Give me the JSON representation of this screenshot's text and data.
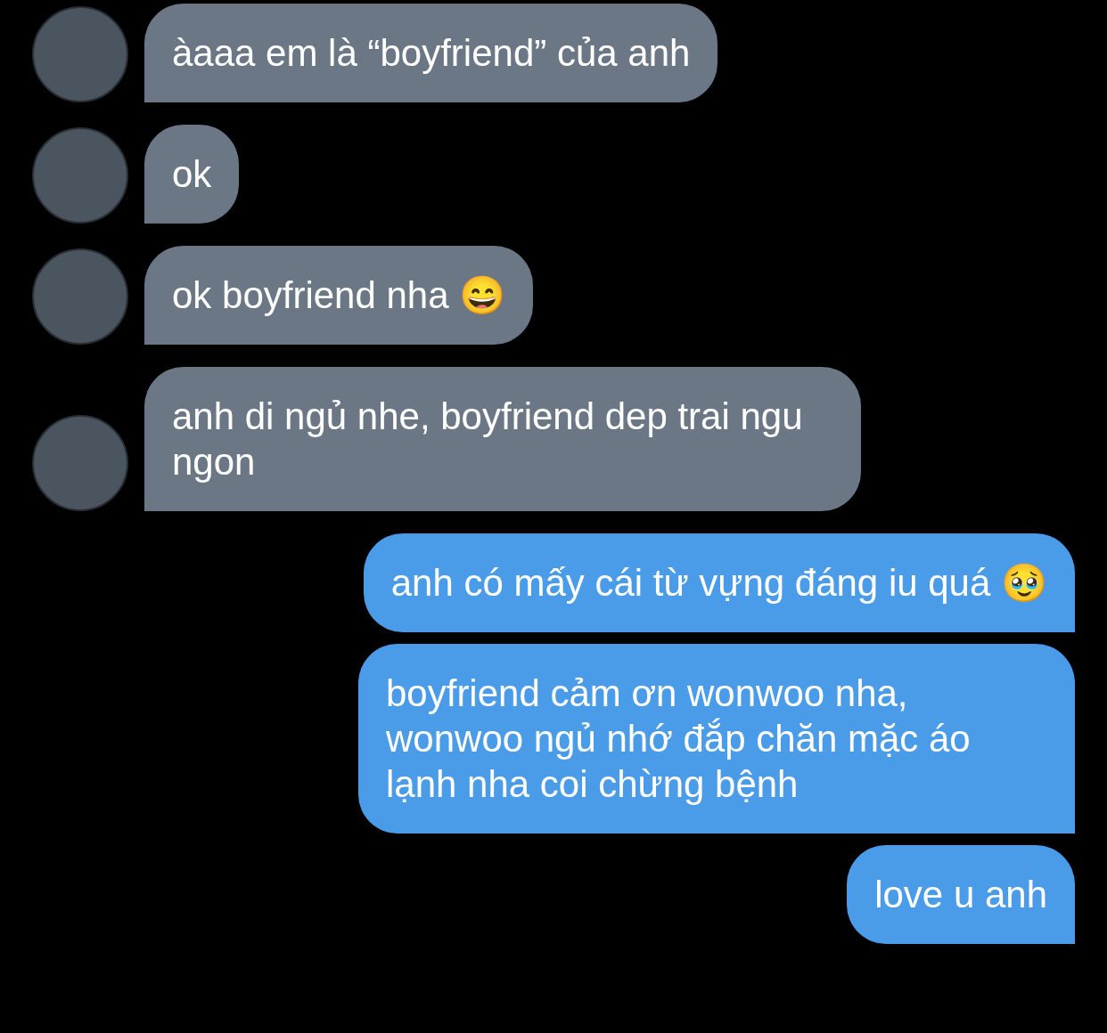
{
  "messages": [
    {
      "kind": "received",
      "text": "àaaa em là “boyfriend” của anh"
    },
    {
      "kind": "received",
      "text": "ok"
    },
    {
      "kind": "received",
      "text": "ok boyfriend nha 😄"
    },
    {
      "kind": "received",
      "text": "anh di ngủ nhe, boyfriend dep trai ngu ngon"
    },
    {
      "kind": "sent",
      "text": "anh có mấy cái từ vựng đáng iu quá 🥹"
    },
    {
      "kind": "sent",
      "text": "boyfriend cảm ơn wonwoo nha, wonwoo ngủ nhớ đắp chăn mặc áo lạnh nha coi chừng bệnh"
    },
    {
      "kind": "sent",
      "text": "love u anh"
    }
  ]
}
